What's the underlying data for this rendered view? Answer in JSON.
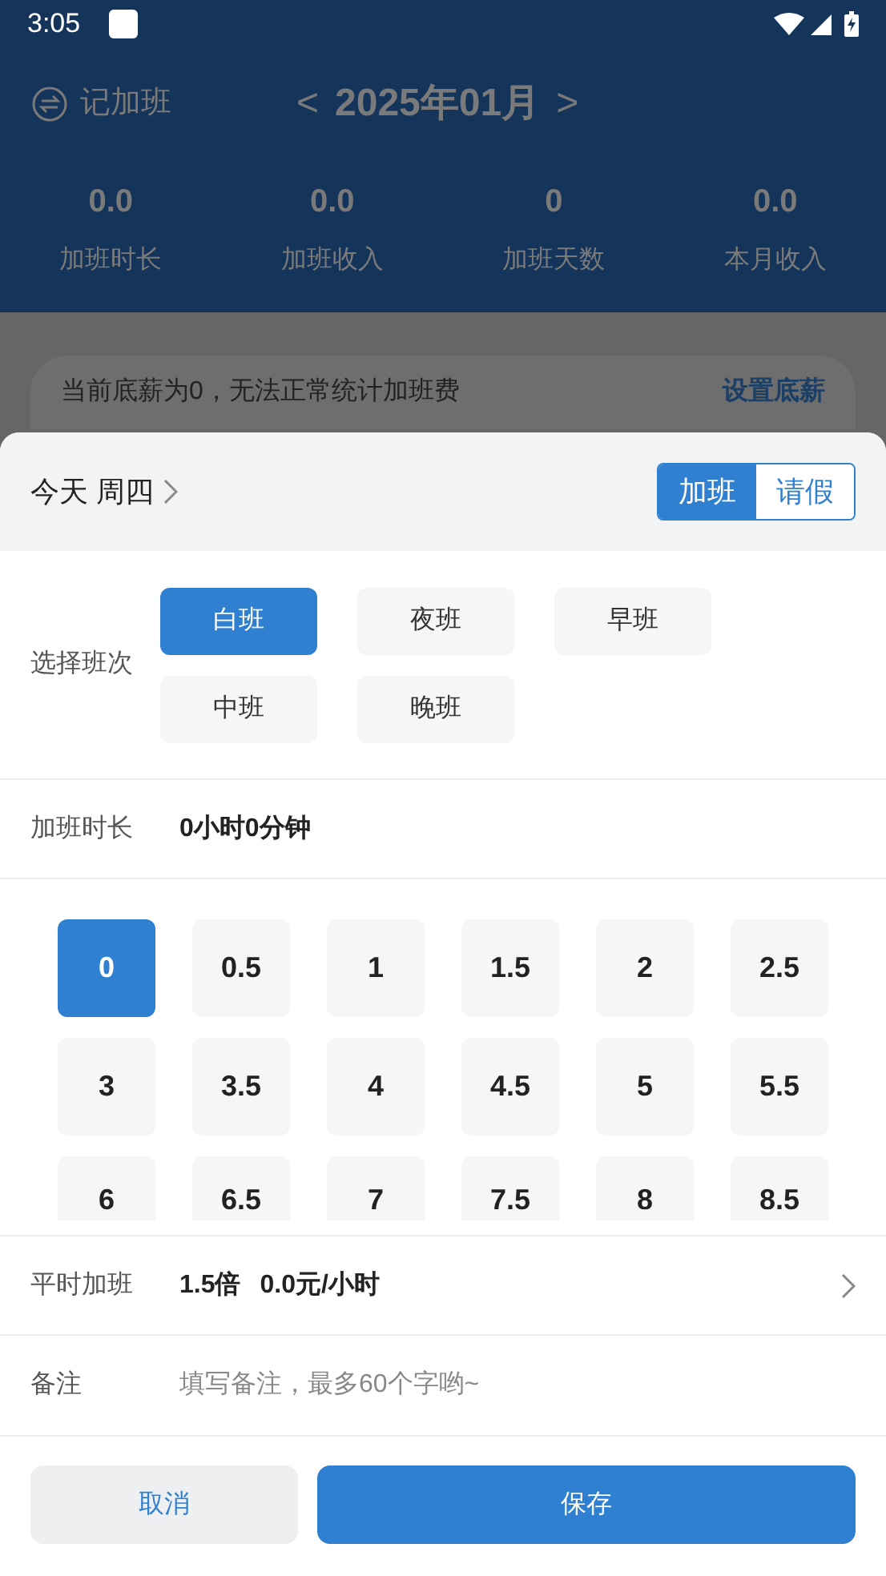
{
  "status_bar": {
    "time": "3:05"
  },
  "header": {
    "title": "记加班",
    "month": "2025年01月",
    "prev": "<",
    "next": ">"
  },
  "stats": [
    {
      "value": "0.0",
      "label": "加班时长"
    },
    {
      "value": "0.0",
      "label": "加班收入"
    },
    {
      "value": "0",
      "label": "加班天数"
    },
    {
      "value": "0.0",
      "label": "本月收入"
    }
  ],
  "notice": {
    "text": "当前底薪为0，无法正常统计加班费",
    "action": "设置底薪"
  },
  "sheet": {
    "date": "今天 周四",
    "mode_tabs": [
      {
        "label": "加班",
        "selected": true
      },
      {
        "label": "请假",
        "selected": false
      }
    ],
    "shift_label": "选择班次",
    "shifts": [
      {
        "label": "白班",
        "selected": true
      },
      {
        "label": "夜班",
        "selected": false
      },
      {
        "label": "早班",
        "selected": false
      },
      {
        "label": "中班",
        "selected": false
      },
      {
        "label": "晚班",
        "selected": false
      }
    ],
    "duration_label": "加班时长",
    "duration_value": "0小时0分钟",
    "hours": [
      {
        "label": "0",
        "selected": true
      },
      {
        "label": "0.5",
        "selected": false
      },
      {
        "label": "1",
        "selected": false
      },
      {
        "label": "1.5",
        "selected": false
      },
      {
        "label": "2",
        "selected": false
      },
      {
        "label": "2.5",
        "selected": false
      },
      {
        "label": "3",
        "selected": false
      },
      {
        "label": "3.5",
        "selected": false
      },
      {
        "label": "4",
        "selected": false
      },
      {
        "label": "4.5",
        "selected": false
      },
      {
        "label": "5",
        "selected": false
      },
      {
        "label": "5.5",
        "selected": false
      },
      {
        "label": "6",
        "selected": false
      },
      {
        "label": "6.5",
        "selected": false
      },
      {
        "label": "7",
        "selected": false
      },
      {
        "label": "7.5",
        "selected": false
      },
      {
        "label": "8",
        "selected": false
      },
      {
        "label": "8.5",
        "selected": false
      }
    ],
    "rate_label": "平时加班",
    "rate_multiplier": "1.5倍",
    "rate_value": "0.0元/小时",
    "note_label": "备注",
    "note_placeholder": "填写备注，最多60个字哟~",
    "cancel": "取消",
    "save": "保存"
  }
}
